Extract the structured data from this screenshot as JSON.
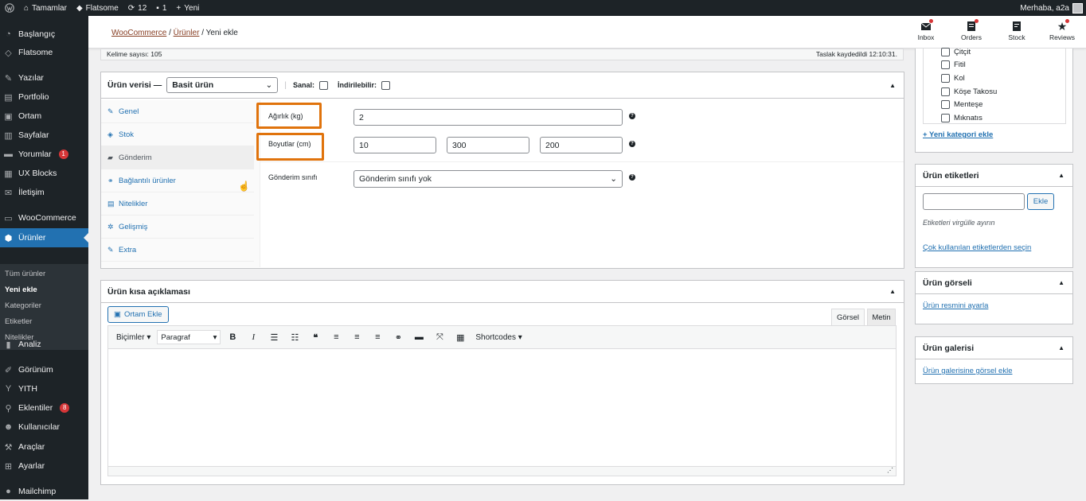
{
  "adminbar": {
    "site": "Tamamlar",
    "theme": "Flatsome",
    "updates": "12",
    "comments": "1",
    "new": "Yeni",
    "greeting": "Merhaba, a2a"
  },
  "sidebar": {
    "items": [
      {
        "label": "Başlangıç",
        "icon": "dashboard-icon"
      },
      {
        "label": "Flatsome",
        "icon": "flatsome-icon"
      },
      {
        "label": "Yazılar",
        "icon": "pin-icon"
      },
      {
        "label": "Portfolio",
        "icon": "portfolio-icon"
      },
      {
        "label": "Ortam",
        "icon": "media-icon"
      },
      {
        "label": "Sayfalar",
        "icon": "pages-icon"
      },
      {
        "label": "Yorumlar",
        "icon": "comments-icon",
        "badge": "1"
      },
      {
        "label": "UX Blocks",
        "icon": "blocks-icon"
      },
      {
        "label": "İletişim",
        "icon": "mail-icon"
      },
      {
        "label": "WooCommerce",
        "icon": "woo-icon"
      },
      {
        "label": "Ürünler",
        "icon": "products-icon"
      },
      {
        "label": "Analiz",
        "icon": "chart-icon"
      },
      {
        "label": "Görünüm",
        "icon": "brush-icon"
      },
      {
        "label": "YITH",
        "icon": "yith-icon"
      },
      {
        "label": "Eklentiler",
        "icon": "plugins-icon",
        "badge": "8"
      },
      {
        "label": "Kullanıcılar",
        "icon": "users-icon"
      },
      {
        "label": "Araçlar",
        "icon": "tools-icon"
      },
      {
        "label": "Ayarlar",
        "icon": "settings-icon"
      },
      {
        "label": "Mailchimp",
        "icon": "mailchimp-icon"
      }
    ],
    "submenu": [
      "Tüm ürünler",
      "Yeni ekle",
      "Kategoriler",
      "Etiketler",
      "Nitelikler"
    ]
  },
  "wcheader": {
    "crumb1": "WooCommerce",
    "crumb2": "Ürünler",
    "crumb3": "Yeni ekle",
    "actions": [
      "Inbox",
      "Orders",
      "Stock",
      "Reviews"
    ]
  },
  "editor_status": {
    "wordcount": "Kelime sayısı: 105",
    "draft_saved": "Taslak kaydedildi 12:10:31."
  },
  "product_data": {
    "title": "Ürün verisi —",
    "type": "Basit ürün",
    "virtual": "Sanal:",
    "downloadable": "İndirilebilir:",
    "tabs": [
      "Genel",
      "Stok",
      "Gönderim",
      "Bağlantılı ürünler",
      "Nitelikler",
      "Gelişmiş",
      "Extra"
    ],
    "active_tab": "Gönderim",
    "weight_label": "Ağırlık (kg)",
    "weight": "2",
    "dims_label": "Boyutlar (cm)",
    "length": "10",
    "width": "300",
    "height": "200",
    "shipping_class_label": "Gönderim sınıfı",
    "shipping_class": "Gönderim sınıfı yok"
  },
  "short_desc": {
    "title": "Ürün kısa açıklaması",
    "add_media": "Ortam Ekle",
    "tab_visual": "Görsel",
    "tab_text": "Metin",
    "formats": "Biçimler",
    "paragraph": "Paragraf",
    "shortcodes": "Shortcodes"
  },
  "categories": {
    "items": [
      "Çitçit",
      "Fitil",
      "Kol",
      "Köşe Takosu",
      "Menteşe",
      "Mıknatıs"
    ],
    "add_new": "+ Yeni kategori ekle"
  },
  "tags": {
    "title": "Ürün etiketleri",
    "add": "Ekle",
    "hint": "Etiketleri virgülle ayırın",
    "choose": "Çok kullanılan etiketlerden seçin"
  },
  "image": {
    "title": "Ürün görseli",
    "link": "Ürün resmini ayarla"
  },
  "gallery": {
    "title": "Ürün galerisi",
    "link": "Ürün galerisine görsel ekle"
  }
}
